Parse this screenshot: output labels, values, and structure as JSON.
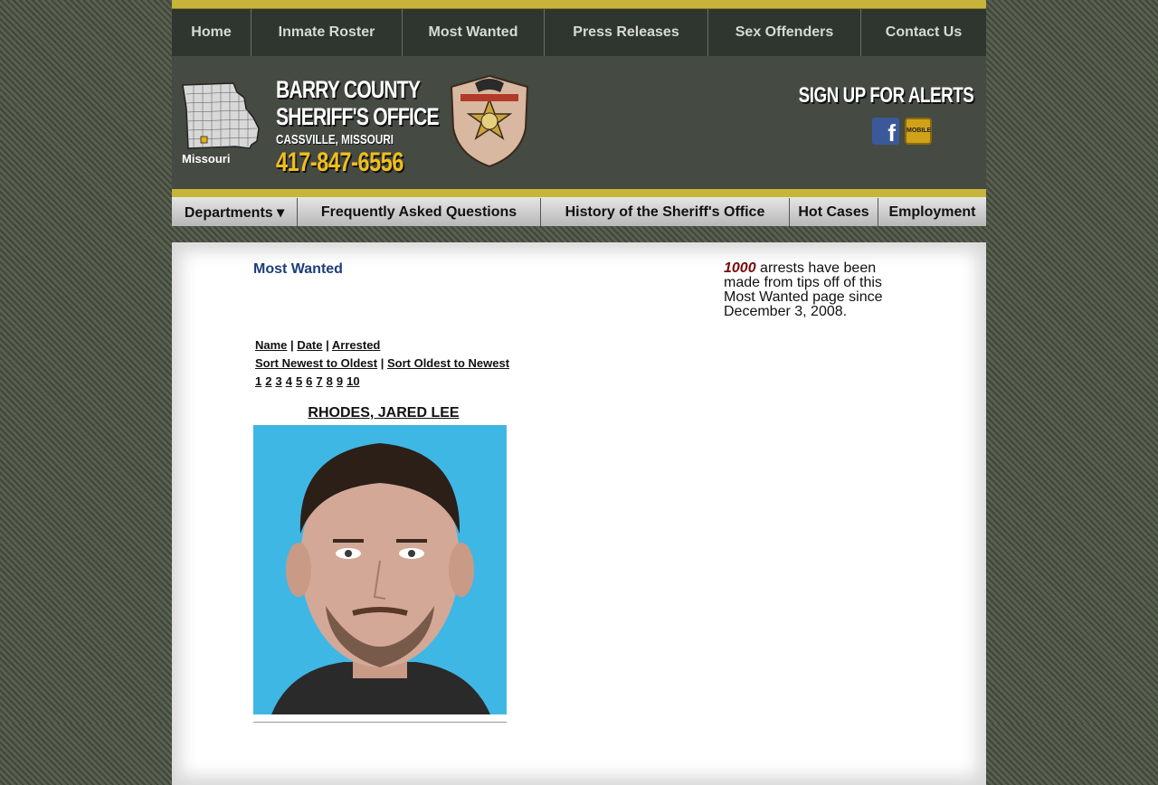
{
  "top_nav": [
    {
      "label": "Home"
    },
    {
      "label": "Inmate Roster"
    },
    {
      "label": "Most Wanted"
    },
    {
      "label": "Press Releases"
    },
    {
      "label": "Sex Offenders"
    },
    {
      "label": "Contact Us"
    }
  ],
  "header": {
    "state_label": "Missouri",
    "title_line1": "BARRY COUNTY",
    "title_line2": "SHERIFF'S OFFICE",
    "city": "CASSVILLE, MISSOURI",
    "phone": "417-847-6556",
    "alerts_title": "SIGN UP FOR ALERTS",
    "facebook_glyph": "f",
    "mobile_label": "MOBILE"
  },
  "sub_nav": [
    {
      "label": "Departments ▾"
    },
    {
      "label": "Frequently Asked Questions"
    },
    {
      "label": "History of the Sheriff's Office"
    },
    {
      "label": "Hot Cases"
    },
    {
      "label": "Employment"
    }
  ],
  "main": {
    "heading": "Most Wanted",
    "arrest_count": "1000",
    "arrest_text": " arrests have been made from tips off of this Most Wanted page since December 3, 2008.",
    "sort_links": {
      "name": "Name",
      "date": "Date",
      "arrested": "Arrested",
      "newest_first": "Sort Newest to Oldest",
      "oldest_first": "Sort Oldest to Newest",
      "separator": "|"
    },
    "pages": [
      "1",
      "2",
      "3",
      "4",
      "5",
      "6",
      "7",
      "8",
      "9",
      "10"
    ],
    "person_name": "RHODES, JARED LEE"
  },
  "colors": {
    "gold": "#c7b43a",
    "phone": "#f1bf1d",
    "heading_blue": "#1d3d7b",
    "count_red": "#7a0a0a"
  }
}
